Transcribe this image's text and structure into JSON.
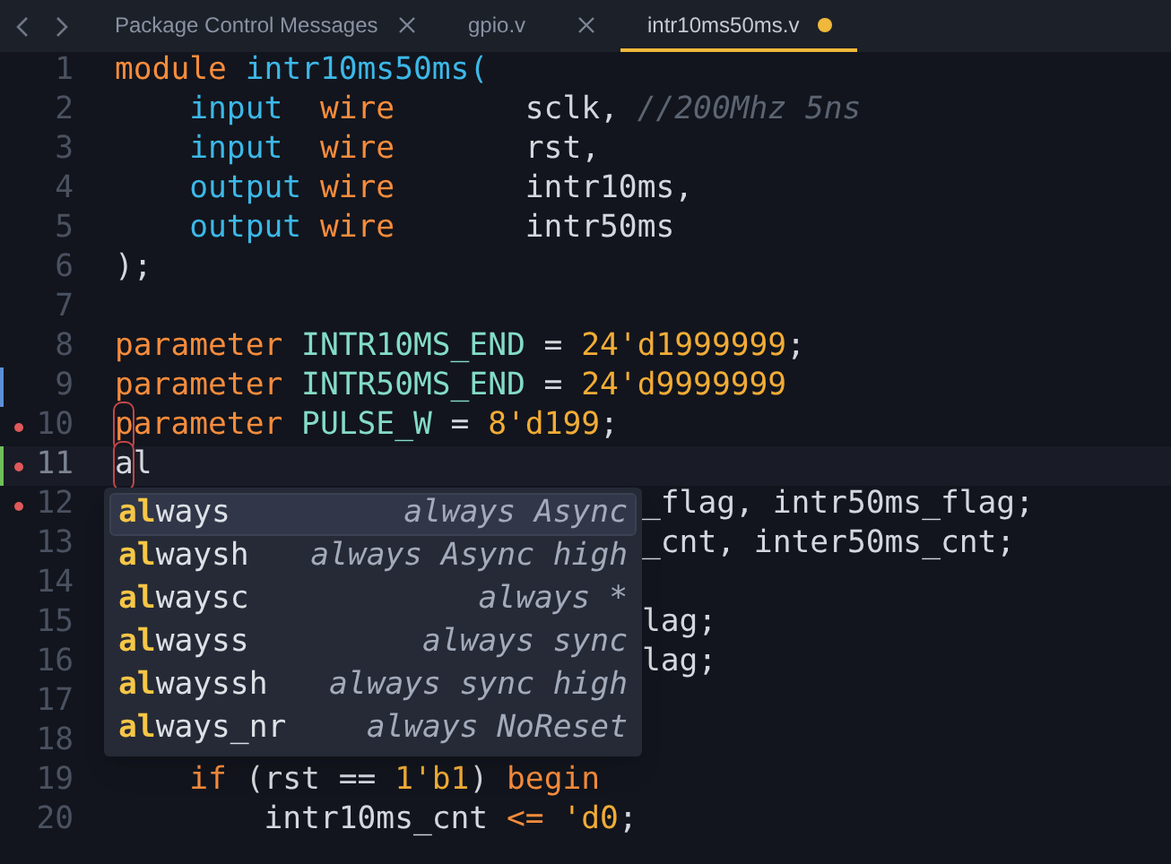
{
  "tabs": [
    {
      "label": "Package Control Messages",
      "selected": false,
      "modified": false
    },
    {
      "label": "gpio.v",
      "selected": false,
      "modified": false
    },
    {
      "label": "intr10ms50ms.v",
      "selected": true,
      "modified": true
    }
  ],
  "lines": [
    {
      "number": "1",
      "tokens": [
        {
          "text": "module ",
          "kind": "keyword"
        },
        {
          "text": "intr10ms50ms(",
          "kind": "type"
        }
      ]
    },
    {
      "number": "2",
      "tokens": [
        {
          "text": "    input  ",
          "kind": "type"
        },
        {
          "text": "wire       ",
          "kind": "keyword"
        },
        {
          "text": "sclk, ",
          "kind": "plain"
        },
        {
          "text": "//200Mhz 5ns",
          "kind": "comment"
        }
      ]
    },
    {
      "number": "3",
      "tokens": [
        {
          "text": "    input  ",
          "kind": "type"
        },
        {
          "text": "wire       ",
          "kind": "keyword"
        },
        {
          "text": "rst,",
          "kind": "plain"
        }
      ]
    },
    {
      "number": "4",
      "tokens": [
        {
          "text": "    output ",
          "kind": "type"
        },
        {
          "text": "wire       ",
          "kind": "keyword"
        },
        {
          "text": "intr10ms,",
          "kind": "plain"
        }
      ]
    },
    {
      "number": "5",
      "tokens": [
        {
          "text": "    output ",
          "kind": "type"
        },
        {
          "text": "wire       ",
          "kind": "keyword"
        },
        {
          "text": "intr50ms",
          "kind": "plain"
        }
      ]
    },
    {
      "number": "6",
      "tokens": [
        {
          "text": ");",
          "kind": "plain"
        }
      ]
    },
    {
      "number": "7"
    },
    {
      "number": "8",
      "tokens": [
        {
          "text": "parameter ",
          "kind": "keyword"
        },
        {
          "text": "INTR10MS_END",
          "kind": "constant"
        },
        {
          "text": " = ",
          "kind": "plain"
        },
        {
          "text": "24'd1999999",
          "kind": "number"
        },
        {
          "text": ";",
          "kind": "plain"
        }
      ]
    },
    {
      "number": "9",
      "modified": true,
      "tokens": [
        {
          "text": "parameter ",
          "kind": "keyword"
        },
        {
          "text": "INTR50MS_END",
          "kind": "constant"
        },
        {
          "text": " = ",
          "kind": "plain"
        },
        {
          "text": "24'd9999999",
          "kind": "number"
        }
      ]
    },
    {
      "number": "10",
      "error": true,
      "tokens": [
        {
          "text": "p",
          "kind": "keyword",
          "flagged": true
        },
        {
          "text": "arameter ",
          "kind": "keyword"
        },
        {
          "text": "PULSE_W",
          "kind": "constant"
        },
        {
          "text": " = ",
          "kind": "plain"
        },
        {
          "text": "8'd199",
          "kind": "number"
        },
        {
          "text": ";",
          "kind": "plain"
        }
      ]
    },
    {
      "number": "11",
      "error": true,
      "added": true,
      "current": true,
      "tokens": [
        {
          "text": "a",
          "kind": "plain",
          "flagged": true
        },
        {
          "text": "l",
          "kind": "plain"
        }
      ]
    },
    {
      "number": "12",
      "error": true,
      "occluded": true,
      "tokens": [
        {
          "text": "_flag, intr50ms_flag;",
          "kind": "plain"
        }
      ]
    },
    {
      "number": "13",
      "occluded": true,
      "tokens": [
        {
          "text": "_cnt, inter50ms_cnt;",
          "kind": "plain"
        }
      ]
    },
    {
      "number": "14"
    },
    {
      "number": "15",
      "occluded": true,
      "tokens": [
        {
          "text": "lag;",
          "kind": "plain"
        }
      ]
    },
    {
      "number": "16",
      "occluded": true,
      "tokens": [
        {
          "text": "lag;",
          "kind": "plain"
        }
      ]
    },
    {
      "number": "17"
    },
    {
      "number": "18"
    },
    {
      "number": "19",
      "tokens": [
        {
          "text": "    if",
          "kind": "keyword"
        },
        {
          "text": " (rst == ",
          "kind": "plain"
        },
        {
          "text": "1'b1",
          "kind": "number"
        },
        {
          "text": ") ",
          "kind": "plain"
        },
        {
          "text": "begin",
          "kind": "keyword"
        }
      ]
    },
    {
      "number": "20",
      "tokens": [
        {
          "text": "        intr10ms_cnt ",
          "kind": "plain"
        },
        {
          "text": "<=",
          "kind": "keyword"
        },
        {
          "text": " 'd0",
          "kind": "number"
        },
        {
          "text": ";",
          "kind": "plain"
        }
      ]
    }
  ],
  "completions": [
    {
      "match": "al",
      "rest": "ways",
      "detail": "always Async",
      "selected": true
    },
    {
      "match": "al",
      "rest": "waysh",
      "detail": "always Async high",
      "selected": false
    },
    {
      "match": "al",
      "rest": "waysc",
      "detail": "always *",
      "selected": false
    },
    {
      "match": "al",
      "rest": "wayss",
      "detail": "always sync",
      "selected": false
    },
    {
      "match": "al",
      "rest": "wayssh",
      "detail": "always sync high",
      "selected": false
    },
    {
      "match": "al",
      "rest": "ways_nr",
      "detail": "always NoReset",
      "selected": false
    }
  ]
}
